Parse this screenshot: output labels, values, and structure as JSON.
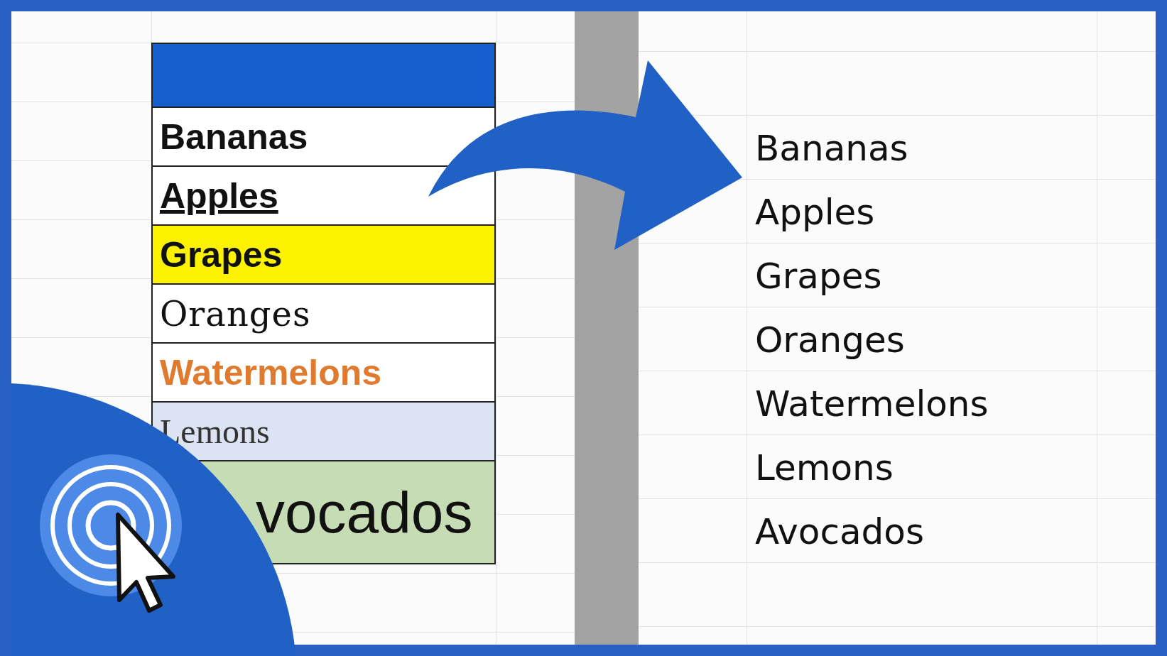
{
  "source_table": {
    "rows": [
      {
        "kind": "header",
        "text": ""
      },
      {
        "kind": "bold",
        "text": "Bananas"
      },
      {
        "kind": "underline",
        "text": "Apples"
      },
      {
        "kind": "highlight",
        "text": "Grapes"
      },
      {
        "kind": "serif",
        "text": "Oranges"
      },
      {
        "kind": "orange",
        "text": "Watermelons"
      },
      {
        "kind": "serif-light",
        "text": "Lemons"
      },
      {
        "kind": "large",
        "text": "vocados"
      }
    ]
  },
  "result_list": {
    "items": [
      "Bananas",
      "Apples",
      "Grapes",
      "Oranges",
      "Watermelons",
      "Lemons",
      "Avocados"
    ]
  }
}
